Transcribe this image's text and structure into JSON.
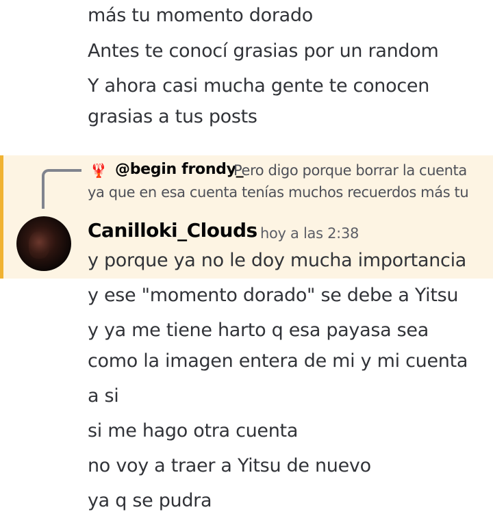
{
  "previous_message": {
    "lines": [
      "más tu momento dorado",
      "Antes te conocí grasias por un random",
      "Y ahora casi mucha gente te conocen",
      "grasias a tus posts"
    ]
  },
  "reply": {
    "avatar_icon": "🦞",
    "username": "@begin frondy_",
    "text_line_1": "Pero digo porque borrar la cuenta",
    "text_line_2": "ya que en esa cuenta tenías muchos recuerdos más tu"
  },
  "message": {
    "username": "Canilloki_Clouds",
    "timestamp": "hoy a las 2:38",
    "highlight_color": "#fdf4e3",
    "mention_bar_color": "#f0b232",
    "lines": [
      "y porque ya no le doy mucha importancia",
      "y ese \"momento dorado\" se debe a Yitsu",
      "y ya me tiene harto q esa payasa sea",
      "como la imagen entera de mi y mi cuenta",
      "a si",
      "si me hago otra cuenta",
      "no voy a traer a Yitsu de nuevo",
      "ya q se pudra"
    ]
  }
}
